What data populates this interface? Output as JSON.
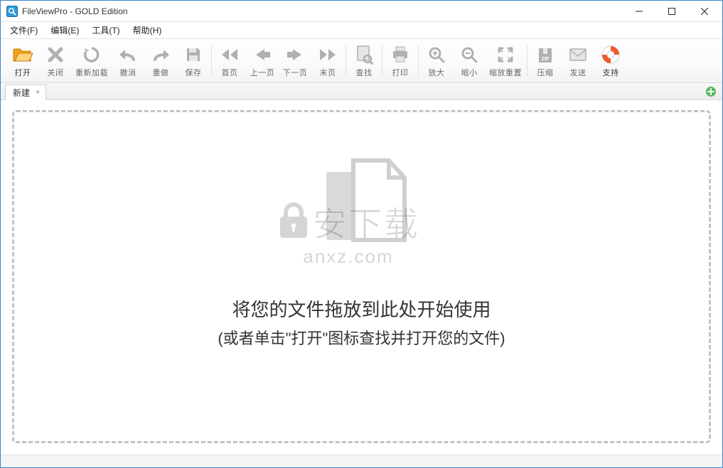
{
  "window": {
    "title": "FileViewPro - GOLD Edition"
  },
  "menu": {
    "file": "文件(F)",
    "edit": "编辑(E)",
    "tools": "工具(T)",
    "help": "帮助(H)"
  },
  "toolbar": {
    "open": "打开",
    "close": "关闭",
    "reload": "重新加载",
    "undo": "撤消",
    "redo": "重做",
    "save": "保存",
    "first": "首页",
    "prev": "上一页",
    "next": "下一页",
    "last": "末页",
    "find": "查找",
    "print": "打印",
    "zoomin": "放大",
    "zoomout": "缩小",
    "zoomreset": "缩放重置",
    "zip": "压缩",
    "send": "发送",
    "support": "支持"
  },
  "tabs": {
    "new": "新建"
  },
  "drop": {
    "line1": "将您的文件拖放到此处开始使用",
    "line2": "(或者单击\"打开\"图标查找并打开您的文件)"
  },
  "watermark": {
    "top": "安下载",
    "bottom": "anxz.com"
  },
  "colors": {
    "accent": "#3a86c8",
    "folder": "#f4a21c",
    "toolbar_grey": "#b0b0b0"
  }
}
